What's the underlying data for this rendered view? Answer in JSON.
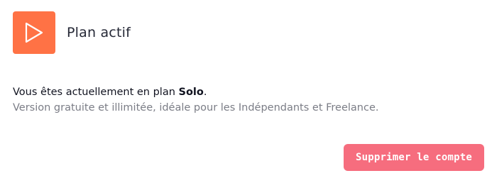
{
  "header": {
    "title": "Plan actif",
    "icon": "play-icon",
    "icon_bg": "#ff7245"
  },
  "plan": {
    "prefix": "Vous êtes actuellement en plan ",
    "name": "Solo",
    "suffix": ".",
    "description": "Version gratuite et illimitée, idéale pour les Indépendants et Freelance."
  },
  "actions": {
    "delete_label": "Supprimer le compte",
    "delete_color": "#f66d7e"
  }
}
